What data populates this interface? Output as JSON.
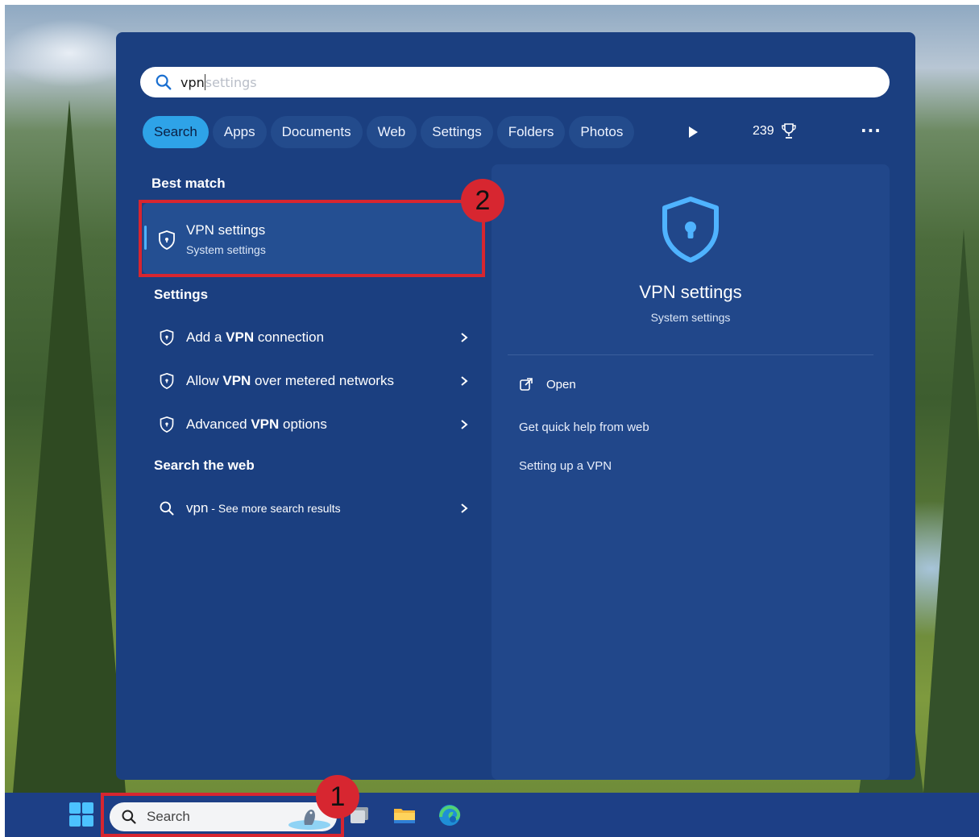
{
  "search": {
    "typed": "vpn",
    "suggestion": "settings",
    "icon": "search-icon"
  },
  "tabs": [
    {
      "label": "Search",
      "active": true
    },
    {
      "label": "Apps"
    },
    {
      "label": "Documents"
    },
    {
      "label": "Web"
    },
    {
      "label": "Settings"
    },
    {
      "label": "Folders"
    },
    {
      "label": "Photos"
    }
  ],
  "toolbar": {
    "points": "239",
    "points_icon": "trophy-icon",
    "more_label": "···",
    "play_icon": "play-icon"
  },
  "best_match": {
    "heading": "Best match",
    "title": "VPN settings",
    "subtitle": "System settings",
    "icon": "shield-icon"
  },
  "settings_section": {
    "heading": "Settings",
    "items": [
      {
        "pre": "Add a ",
        "bold": "VPN",
        "post": " connection",
        "icon": "shield-icon"
      },
      {
        "pre": "Allow ",
        "bold": "VPN",
        "post": " over metered networks",
        "icon": "shield-icon"
      },
      {
        "pre": "Advanced ",
        "bold": "VPN",
        "post": " options",
        "icon": "shield-icon"
      }
    ]
  },
  "web_section": {
    "heading": "Search the web",
    "query": "vpn",
    "suffix": " - See more search results"
  },
  "preview": {
    "title": "VPN settings",
    "subtitle": "System settings",
    "open_label": "Open",
    "help_heading": "Get quick help from web",
    "help_links": [
      "Setting up a VPN"
    ]
  },
  "taskbar": {
    "search_label": "Search",
    "apps": [
      "task-view-icon",
      "file-explorer-icon",
      "edge-icon"
    ]
  },
  "annotations": [
    {
      "label": "1",
      "target": "taskbar-search"
    },
    {
      "label": "2",
      "target": "best-match-card"
    }
  ],
  "colors": {
    "panel": "#1b3f80",
    "accent": "#2ea3e8",
    "annotation": "#d72630",
    "taskbar": "#1d3f86"
  }
}
